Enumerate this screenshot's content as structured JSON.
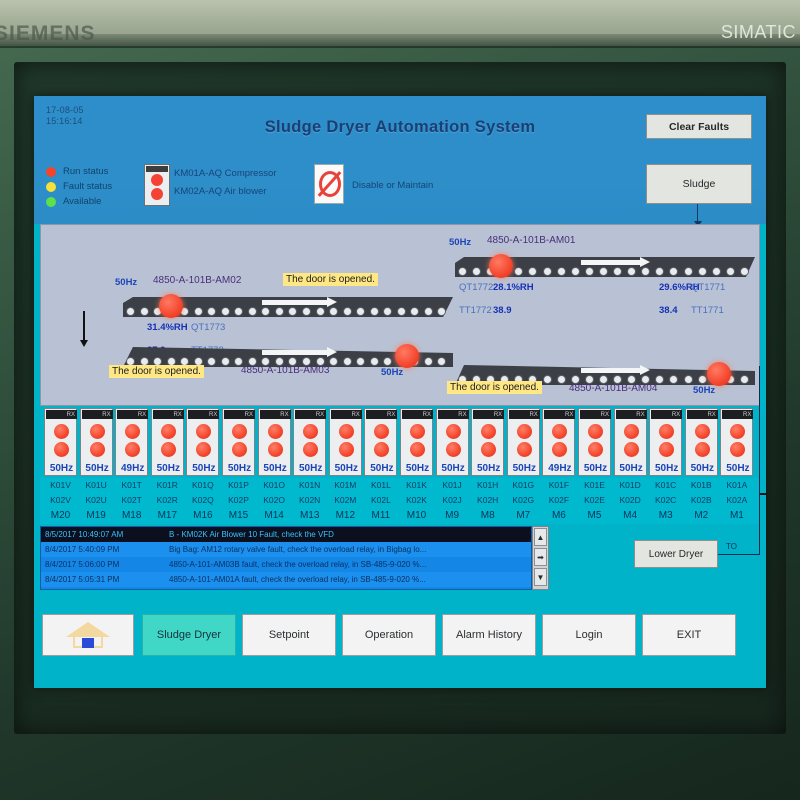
{
  "device": {
    "brand_left": "SIEMENS",
    "brand_right": "SIMATIC"
  },
  "header": {
    "date": "17-08-05",
    "time": "15:16:14",
    "title": "Sludge Dryer Automation System",
    "clear_faults_label": "Clear Faults",
    "sludge_label": "Sludge"
  },
  "legend": {
    "items": [
      {
        "label": "Run status",
        "color": "#f4452c"
      },
      {
        "label": "Fault status",
        "color": "#f5e03c"
      },
      {
        "label": "Available",
        "color": "#5ee04a"
      }
    ],
    "contactor_lines": [
      "KM01A-AQ Compressor",
      "KM02A-AQ Air blower"
    ],
    "disable_label": "Disable or Maintain"
  },
  "belts": [
    {
      "id": "belt-1",
      "name": "4850-A-101B-AM01",
      "hz": "50Hz",
      "qt_left": "QT1772",
      "rh_left": "28.1%RH",
      "tt_left": "TT1772",
      "temp_left": "38.9",
      "qt_right": "QT1771",
      "rh_right": "29.6%RH",
      "tt_right": "TT1771",
      "temp_right": "38.4",
      "door_msg": null
    },
    {
      "id": "belt-2",
      "name": "4850-A-101B-AM02",
      "hz": "50Hz",
      "qt_left": "QT1773",
      "rh_left": "31.4%RH",
      "tt_left": "TT1773",
      "temp_left": "37.9",
      "qt_right": null,
      "rh_right": null,
      "tt_right": null,
      "temp_right": null,
      "door_msg": "The door is opened."
    },
    {
      "id": "belt-3",
      "name": "4850-A-101B-AM03",
      "hz": "50Hz",
      "qt_left": null,
      "rh_left": null,
      "tt_left": null,
      "temp_left": null,
      "qt_right": null,
      "rh_right": null,
      "tt_right": null,
      "temp_right": null,
      "door_msg": "The door is opened."
    },
    {
      "id": "belt-4",
      "name": "4850-A-101B-AM04",
      "hz": "50Hz",
      "qt_left": null,
      "rh_left": null,
      "tt_left": null,
      "temp_left": null,
      "qt_right": null,
      "rh_right": null,
      "tt_right": null,
      "temp_right": null,
      "door_msg": "The door is opened."
    }
  ],
  "vfd_array": {
    "cap_label": "RX",
    "units": [
      {
        "hz": "50Hz",
        "k1": "K01V",
        "k2": "K02V",
        "m": "M20"
      },
      {
        "hz": "50Hz",
        "k1": "K01U",
        "k2": "K02U",
        "m": "M19"
      },
      {
        "hz": "49Hz",
        "k1": "K01T",
        "k2": "K02T",
        "m": "M18"
      },
      {
        "hz": "50Hz",
        "k1": "K01R",
        "k2": "K02R",
        "m": "M17"
      },
      {
        "hz": "50Hz",
        "k1": "K01Q",
        "k2": "K02Q",
        "m": "M16"
      },
      {
        "hz": "50Hz",
        "k1": "K01P",
        "k2": "K02P",
        "m": "M15"
      },
      {
        "hz": "50Hz",
        "k1": "K01O",
        "k2": "K02O",
        "m": "M14"
      },
      {
        "hz": "50Hz",
        "k1": "K01N",
        "k2": "K02N",
        "m": "M13"
      },
      {
        "hz": "50Hz",
        "k1": "K01M",
        "k2": "K02M",
        "m": "M12"
      },
      {
        "hz": "50Hz",
        "k1": "K01L",
        "k2": "K02L",
        "m": "M11"
      },
      {
        "hz": "50Hz",
        "k1": "K01K",
        "k2": "K02K",
        "m": "M10"
      },
      {
        "hz": "50Hz",
        "k1": "K01J",
        "k2": "K02J",
        "m": "M9"
      },
      {
        "hz": "50Hz",
        "k1": "K01H",
        "k2": "K02H",
        "m": "M8"
      },
      {
        "hz": "50Hz",
        "k1": "K01G",
        "k2": "K02G",
        "m": "M7"
      },
      {
        "hz": "49Hz",
        "k1": "K01F",
        "k2": "K02F",
        "m": "M6"
      },
      {
        "hz": "50Hz",
        "k1": "K01E",
        "k2": "K02E",
        "m": "M5"
      },
      {
        "hz": "50Hz",
        "k1": "K01D",
        "k2": "K02D",
        "m": "M4"
      },
      {
        "hz": "50Hz",
        "k1": "K01C",
        "k2": "K02C",
        "m": "M3"
      },
      {
        "hz": "50Hz",
        "k1": "K01B",
        "k2": "K02B",
        "m": "M2"
      },
      {
        "hz": "50Hz",
        "k1": "K01A",
        "k2": "K02A",
        "m": "M1"
      }
    ]
  },
  "alarms": {
    "rows": [
      {
        "time": "8/5/2017 10:49:07 AM",
        "message": "B - KM02K Air Blower 10 Fault, check the VFD",
        "selected": true
      },
      {
        "time": "8/4/2017 5:40:09 PM",
        "message": "Big Bag: AM12 rotary valve fault, check the overload relay, in Bigbag lo...",
        "selected": false
      },
      {
        "time": "8/4/2017 5:06:00 PM",
        "message": "4850-A-101-AM03B fault, check the overload relay, in SB-485-9-020 %...",
        "selected": false
      },
      {
        "time": "8/4/2017 5:05:31 PM",
        "message": "4850-A-101-AM01A fault, check the overload relay, in SB-485-9-020 %...",
        "selected": false
      }
    ],
    "scroll_up": "▲",
    "scroll_right": "➡",
    "scroll_down": "▼"
  },
  "controls": {
    "lower_dryer_label": "Lower Dryer",
    "to_label": "TO"
  },
  "nav": {
    "home_icon": "home-icon",
    "buttons": [
      {
        "label": "Sludge Dryer",
        "active": true
      },
      {
        "label": "Setpoint",
        "active": false
      },
      {
        "label": "Operation",
        "active": false
      },
      {
        "label": "Alarm History",
        "active": false
      },
      {
        "label": "Login",
        "active": false
      },
      {
        "label": "EXIT",
        "active": false
      }
    ]
  }
}
